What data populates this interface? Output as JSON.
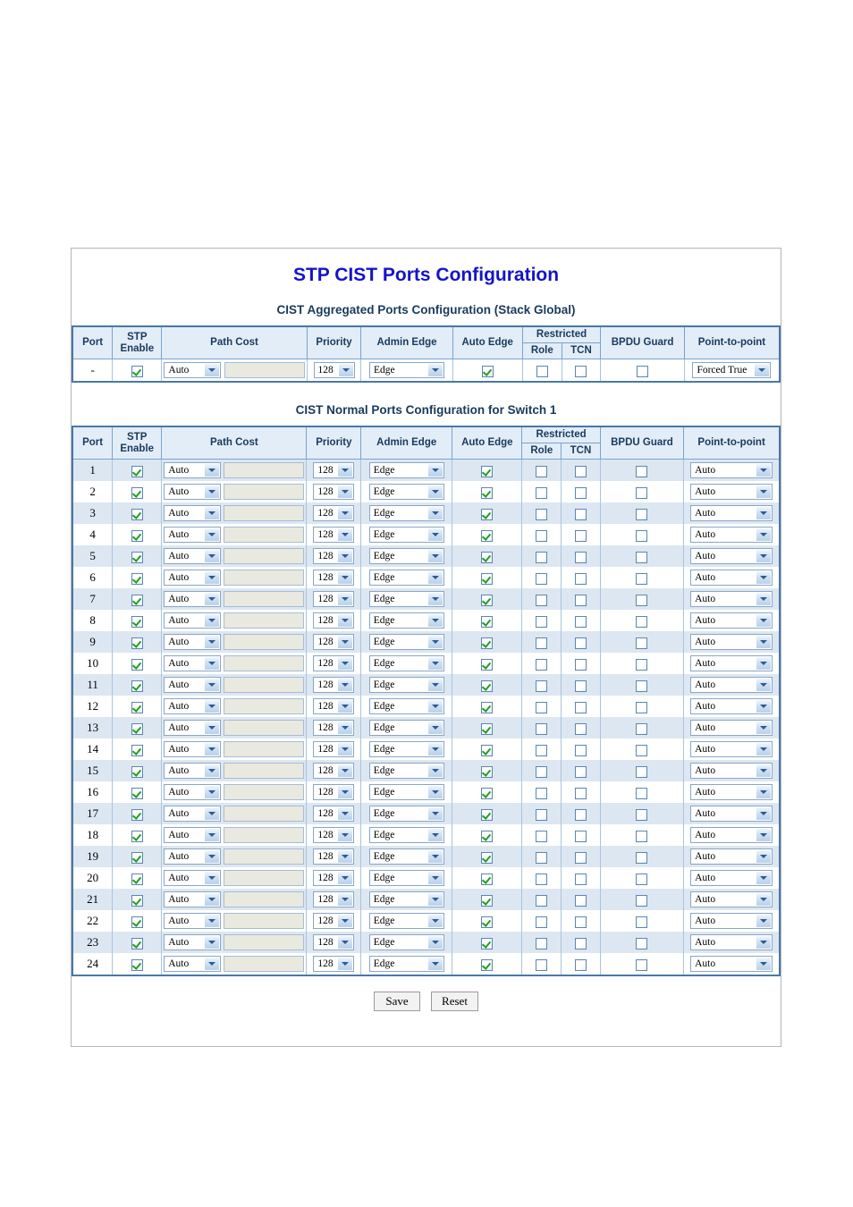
{
  "page": {
    "title": "STP CIST Ports Configuration"
  },
  "aggregated": {
    "section_title": "CIST Aggregated Ports Configuration (Stack Global)",
    "headers": {
      "port": "Port",
      "stp_enable": "STP Enable",
      "stp_enable_l1": "STP",
      "stp_enable_l2": "Enable",
      "path_cost": "Path Cost",
      "priority": "Priority",
      "admin_edge": "Admin Edge",
      "auto_edge": "Auto Edge",
      "restricted": "Restricted",
      "role": "Role",
      "tcn": "TCN",
      "bpdu_guard": "BPDU Guard",
      "point_to_point": "Point-to-point"
    },
    "row": {
      "port": "-",
      "stp_enable": true,
      "path_cost": "Auto",
      "path_cost_value": "",
      "priority": "128",
      "admin_edge": "Edge",
      "auto_edge": true,
      "restricted_role": false,
      "restricted_tcn": false,
      "bpdu_guard": false,
      "point_to_point": "Forced True"
    }
  },
  "normal": {
    "section_title": "CIST Normal Ports Configuration for Switch 1",
    "headers": {
      "port": "Port",
      "stp_enable_l1": "STP",
      "stp_enable_l2": "Enable",
      "path_cost": "Path Cost",
      "priority": "Priority",
      "admin_edge": "Admin Edge",
      "auto_edge": "Auto Edge",
      "restricted": "Restricted",
      "role": "Role",
      "tcn": "TCN",
      "bpdu_guard": "BPDU Guard",
      "point_to_point": "Point-to-point"
    },
    "rows": [
      {
        "port": "1",
        "stp_enable": true,
        "path_cost": "Auto",
        "path_cost_value": "",
        "priority": "128",
        "admin_edge": "Edge",
        "auto_edge": true,
        "restricted_role": false,
        "restricted_tcn": false,
        "bpdu_guard": false,
        "point_to_point": "Auto"
      },
      {
        "port": "2",
        "stp_enable": true,
        "path_cost": "Auto",
        "path_cost_value": "",
        "priority": "128",
        "admin_edge": "Edge",
        "auto_edge": true,
        "restricted_role": false,
        "restricted_tcn": false,
        "bpdu_guard": false,
        "point_to_point": "Auto"
      },
      {
        "port": "3",
        "stp_enable": true,
        "path_cost": "Auto",
        "path_cost_value": "",
        "priority": "128",
        "admin_edge": "Edge",
        "auto_edge": true,
        "restricted_role": false,
        "restricted_tcn": false,
        "bpdu_guard": false,
        "point_to_point": "Auto"
      },
      {
        "port": "4",
        "stp_enable": true,
        "path_cost": "Auto",
        "path_cost_value": "",
        "priority": "128",
        "admin_edge": "Edge",
        "auto_edge": true,
        "restricted_role": false,
        "restricted_tcn": false,
        "bpdu_guard": false,
        "point_to_point": "Auto"
      },
      {
        "port": "5",
        "stp_enable": true,
        "path_cost": "Auto",
        "path_cost_value": "",
        "priority": "128",
        "admin_edge": "Edge",
        "auto_edge": true,
        "restricted_role": false,
        "restricted_tcn": false,
        "bpdu_guard": false,
        "point_to_point": "Auto"
      },
      {
        "port": "6",
        "stp_enable": true,
        "path_cost": "Auto",
        "path_cost_value": "",
        "priority": "128",
        "admin_edge": "Edge",
        "auto_edge": true,
        "restricted_role": false,
        "restricted_tcn": false,
        "bpdu_guard": false,
        "point_to_point": "Auto"
      },
      {
        "port": "7",
        "stp_enable": true,
        "path_cost": "Auto",
        "path_cost_value": "",
        "priority": "128",
        "admin_edge": "Edge",
        "auto_edge": true,
        "restricted_role": false,
        "restricted_tcn": false,
        "bpdu_guard": false,
        "point_to_point": "Auto"
      },
      {
        "port": "8",
        "stp_enable": true,
        "path_cost": "Auto",
        "path_cost_value": "",
        "priority": "128",
        "admin_edge": "Edge",
        "auto_edge": true,
        "restricted_role": false,
        "restricted_tcn": false,
        "bpdu_guard": false,
        "point_to_point": "Auto"
      },
      {
        "port": "9",
        "stp_enable": true,
        "path_cost": "Auto",
        "path_cost_value": "",
        "priority": "128",
        "admin_edge": "Edge",
        "auto_edge": true,
        "restricted_role": false,
        "restricted_tcn": false,
        "bpdu_guard": false,
        "point_to_point": "Auto"
      },
      {
        "port": "10",
        "stp_enable": true,
        "path_cost": "Auto",
        "path_cost_value": "",
        "priority": "128",
        "admin_edge": "Edge",
        "auto_edge": true,
        "restricted_role": false,
        "restricted_tcn": false,
        "bpdu_guard": false,
        "point_to_point": "Auto"
      },
      {
        "port": "11",
        "stp_enable": true,
        "path_cost": "Auto",
        "path_cost_value": "",
        "priority": "128",
        "admin_edge": "Edge",
        "auto_edge": true,
        "restricted_role": false,
        "restricted_tcn": false,
        "bpdu_guard": false,
        "point_to_point": "Auto"
      },
      {
        "port": "12",
        "stp_enable": true,
        "path_cost": "Auto",
        "path_cost_value": "",
        "priority": "128",
        "admin_edge": "Edge",
        "auto_edge": true,
        "restricted_role": false,
        "restricted_tcn": false,
        "bpdu_guard": false,
        "point_to_point": "Auto"
      },
      {
        "port": "13",
        "stp_enable": true,
        "path_cost": "Auto",
        "path_cost_value": "",
        "priority": "128",
        "admin_edge": "Edge",
        "auto_edge": true,
        "restricted_role": false,
        "restricted_tcn": false,
        "bpdu_guard": false,
        "point_to_point": "Auto"
      },
      {
        "port": "14",
        "stp_enable": true,
        "path_cost": "Auto",
        "path_cost_value": "",
        "priority": "128",
        "admin_edge": "Edge",
        "auto_edge": true,
        "restricted_role": false,
        "restricted_tcn": false,
        "bpdu_guard": false,
        "point_to_point": "Auto"
      },
      {
        "port": "15",
        "stp_enable": true,
        "path_cost": "Auto",
        "path_cost_value": "",
        "priority": "128",
        "admin_edge": "Edge",
        "auto_edge": true,
        "restricted_role": false,
        "restricted_tcn": false,
        "bpdu_guard": false,
        "point_to_point": "Auto"
      },
      {
        "port": "16",
        "stp_enable": true,
        "path_cost": "Auto",
        "path_cost_value": "",
        "priority": "128",
        "admin_edge": "Edge",
        "auto_edge": true,
        "restricted_role": false,
        "restricted_tcn": false,
        "bpdu_guard": false,
        "point_to_point": "Auto"
      },
      {
        "port": "17",
        "stp_enable": true,
        "path_cost": "Auto",
        "path_cost_value": "",
        "priority": "128",
        "admin_edge": "Edge",
        "auto_edge": true,
        "restricted_role": false,
        "restricted_tcn": false,
        "bpdu_guard": false,
        "point_to_point": "Auto"
      },
      {
        "port": "18",
        "stp_enable": true,
        "path_cost": "Auto",
        "path_cost_value": "",
        "priority": "128",
        "admin_edge": "Edge",
        "auto_edge": true,
        "restricted_role": false,
        "restricted_tcn": false,
        "bpdu_guard": false,
        "point_to_point": "Auto"
      },
      {
        "port": "19",
        "stp_enable": true,
        "path_cost": "Auto",
        "path_cost_value": "",
        "priority": "128",
        "admin_edge": "Edge",
        "auto_edge": true,
        "restricted_role": false,
        "restricted_tcn": false,
        "bpdu_guard": false,
        "point_to_point": "Auto"
      },
      {
        "port": "20",
        "stp_enable": true,
        "path_cost": "Auto",
        "path_cost_value": "",
        "priority": "128",
        "admin_edge": "Edge",
        "auto_edge": true,
        "restricted_role": false,
        "restricted_tcn": false,
        "bpdu_guard": false,
        "point_to_point": "Auto"
      },
      {
        "port": "21",
        "stp_enable": true,
        "path_cost": "Auto",
        "path_cost_value": "",
        "priority": "128",
        "admin_edge": "Edge",
        "auto_edge": true,
        "restricted_role": false,
        "restricted_tcn": false,
        "bpdu_guard": false,
        "point_to_point": "Auto"
      },
      {
        "port": "22",
        "stp_enable": true,
        "path_cost": "Auto",
        "path_cost_value": "",
        "priority": "128",
        "admin_edge": "Edge",
        "auto_edge": true,
        "restricted_role": false,
        "restricted_tcn": false,
        "bpdu_guard": false,
        "point_to_point": "Auto"
      },
      {
        "port": "23",
        "stp_enable": true,
        "path_cost": "Auto",
        "path_cost_value": "",
        "priority": "128",
        "admin_edge": "Edge",
        "auto_edge": true,
        "restricted_role": false,
        "restricted_tcn": false,
        "bpdu_guard": false,
        "point_to_point": "Auto"
      },
      {
        "port": "24",
        "stp_enable": true,
        "path_cost": "Auto",
        "path_cost_value": "",
        "priority": "128",
        "admin_edge": "Edge",
        "auto_edge": true,
        "restricted_role": false,
        "restricted_tcn": false,
        "bpdu_guard": false,
        "point_to_point": "Auto"
      }
    ]
  },
  "buttons": {
    "save": "Save",
    "reset": "Reset"
  },
  "colors": {
    "title": "#1414c8",
    "section_title": "#1a3a5c",
    "table_border": "#4878a8",
    "header_bg": "#e2edf8",
    "odd_row_bg": "#dde7f2",
    "frame_border": "#b4b4b4",
    "check_green": "#1e9e22"
  }
}
